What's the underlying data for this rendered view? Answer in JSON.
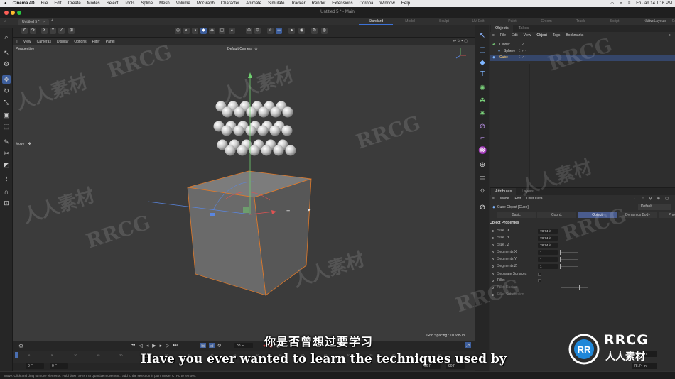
{
  "macos_menubar": {
    "app_name": "Cinema 4D",
    "items": [
      "File",
      "Edit",
      "Create",
      "Modes",
      "Select",
      "Tools",
      "Spline",
      "Mesh",
      "Volume",
      "MoGraph",
      "Character",
      "Animate",
      "Simulate",
      "Tracker",
      "Render",
      "Extensions",
      "Corona",
      "Window",
      "Help"
    ],
    "clock": "Fri Jan 14  1:16 PM"
  },
  "window": {
    "title": "Untitled 5 * - Main",
    "document_tab": "Untitled 5 *",
    "layouts": [
      "Standard",
      "Model",
      "Sculpt",
      "UV Edit",
      "Paint",
      "Groom",
      "Track",
      "Script",
      "Nodes",
      "Corona Coect"
    ],
    "active_layout": "Standard",
    "new_layouts_label": "New Layouts"
  },
  "toolbar": {
    "axis_buttons": [
      "X",
      "Y",
      "Z"
    ]
  },
  "viewport": {
    "menu": [
      "View",
      "Cameras",
      "Display",
      "Options",
      "Filter",
      "Panel"
    ],
    "projection_label": "Perspective",
    "camera_label": "Default Camera",
    "tool_label": "Move",
    "grid_spacing": "Grid Spacing : 10.695 in"
  },
  "subtitles": {
    "chinese": "你是否曾想过要学习",
    "english": "Have you ever wanted to learn the techniques used by"
  },
  "timeline": {
    "current_frame": "38 F",
    "start_frame": "0 F",
    "start_frame_2": "0 F",
    "ruler_ticks": [
      "0",
      "5",
      "10",
      "15",
      "20",
      "25",
      "30",
      "35",
      "40",
      "45",
      "50",
      "55",
      "60",
      "65",
      "70",
      "75",
      "80",
      "85",
      "90"
    ],
    "end_frame": "90 F",
    "end_frame_2": "90 F"
  },
  "statusbar": {
    "text": "Move: Click and drag to move elements. Hold down SHIFT to quantize movement / add to the selection in point mode, CTRL to remove."
  },
  "objects_panel": {
    "tabs": [
      "Objects",
      "Takes"
    ],
    "active_tab": "Objects",
    "menu": [
      "File",
      "Edit",
      "View",
      "Object",
      "Tags",
      "Bookmarks"
    ],
    "items": [
      {
        "name": "Cloner",
        "indent": 0,
        "selected": false
      },
      {
        "name": "Sphere",
        "indent": 1,
        "selected": false
      },
      {
        "name": "Cube",
        "indent": 0,
        "selected": true
      }
    ]
  },
  "attributes_panel": {
    "tabs": [
      "Attributes",
      "Layers"
    ],
    "active_tab": "Attributes",
    "menu": [
      "Mode",
      "Edit",
      "User Data"
    ],
    "preset": "Default",
    "object_title": "Cube Object [Cube]",
    "subtabs": [
      "Basic",
      "Coord.",
      "Object",
      "Dynamics Body",
      "Phong"
    ],
    "active_subtab": "Object",
    "section_title": "Object Properties",
    "properties": [
      {
        "label": "Size . X",
        "value": "78.74 in",
        "slider": false
      },
      {
        "label": "Size . Y",
        "value": "78.74 in",
        "slider": false
      },
      {
        "label": "Size . Z",
        "value": "78.74 in",
        "slider": false
      },
      {
        "label": "Segments X",
        "value": "1",
        "slider": true
      },
      {
        "label": "Segments Y",
        "value": "1",
        "slider": true
      },
      {
        "label": "Segments Z",
        "value": "1",
        "slider": true
      },
      {
        "label": "Separate Surfaces",
        "value": "",
        "slider": false
      },
      {
        "label": "Fillet",
        "value": "",
        "slider": false
      },
      {
        "label": "Fillet Radius",
        "value": "",
        "slider": true
      },
      {
        "label": "Fillet Subdivision",
        "value": "",
        "slider": false
      }
    ],
    "bottom_values": [
      "78.74 in",
      "78.74 in"
    ]
  },
  "watermarks": {
    "brand": "RRCG",
    "cn": "人人素材"
  },
  "colors": {
    "accent": "#3c72d8",
    "selection": "#35466a",
    "viewport_bg": "#3b3b3b",
    "cube_outline": "#e07a2a"
  }
}
